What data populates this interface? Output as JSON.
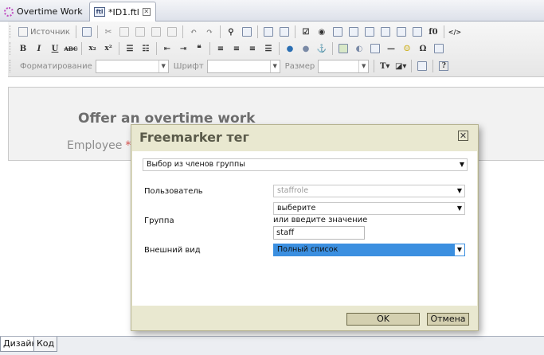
{
  "tabs": [
    {
      "label": "Overtime Work",
      "icon": "overtime-gear-icon"
    },
    {
      "label": "*ID1.ftl",
      "icon": "ftl-file-icon"
    }
  ],
  "toolbar": {
    "source_label": "Источник",
    "format_label": "Форматирование",
    "font_label": "Шрифт",
    "size_label": "Размер",
    "format_value": "",
    "font_value": "",
    "size_value": ""
  },
  "document": {
    "title": "Offer an overtime work",
    "employee_label": "Employee",
    "required_mark": "*"
  },
  "dialog": {
    "title": "Freemarker тег",
    "mode_value": "Выбор из членов группы",
    "user_label": "Пользователь",
    "user_value": "staffrole",
    "group_label": "Группа",
    "group_value": "выберите",
    "group_hint": "или введите значение",
    "group_input": "staff",
    "view_label": "Внешний вид",
    "view_value": "Полный список",
    "ok_label": "OK",
    "cancel_label": "Отмена"
  },
  "bottom_tabs": [
    {
      "label": "Дизайн"
    },
    {
      "label": "Код"
    }
  ],
  "colors": {
    "accent": "#3b8fe0",
    "dialog_bg": "#e9e8d0",
    "required": "#d9534f"
  }
}
